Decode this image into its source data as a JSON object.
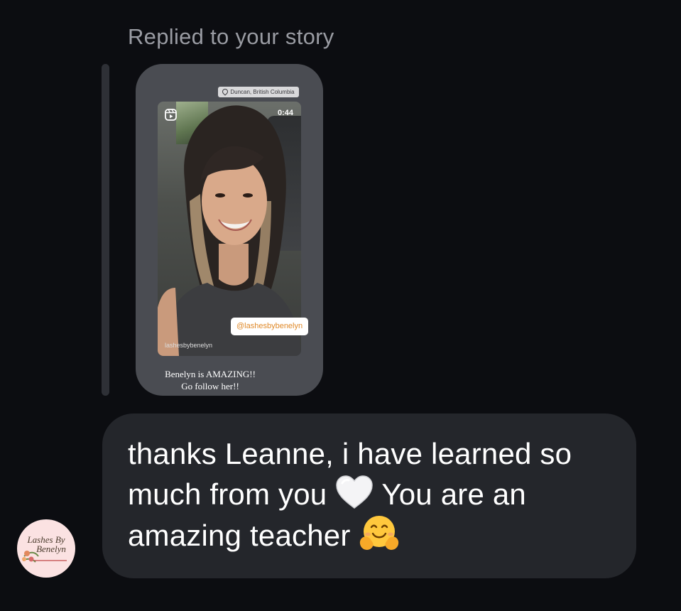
{
  "reply_header": {
    "label": "Replied to your story"
  },
  "story": {
    "location": "Duncan, British Columbia",
    "duration": "0:44",
    "reel_username": "lashesbybenelyn",
    "mention": "@lashesbybenelyn",
    "caption_line1": "Benelyn is AMAZING!!",
    "caption_line2": "Go follow her!!",
    "reel_icon": "reels-icon",
    "location_icon": "location-pin-icon"
  },
  "message": {
    "text_part1": "thanks Leanne, i have learned so much from you",
    "emoji1": "white-heart-emoji",
    "text_part2": "You are an amazing teacher",
    "emoji2": "hugging-face-emoji"
  },
  "avatar": {
    "line1": "Lashes By",
    "line2": "Benelyn"
  },
  "colors": {
    "background": "#0c0d11",
    "bubble": "#24262b",
    "story_card": "#4a4c52",
    "muted_text": "#9a9ca3"
  }
}
